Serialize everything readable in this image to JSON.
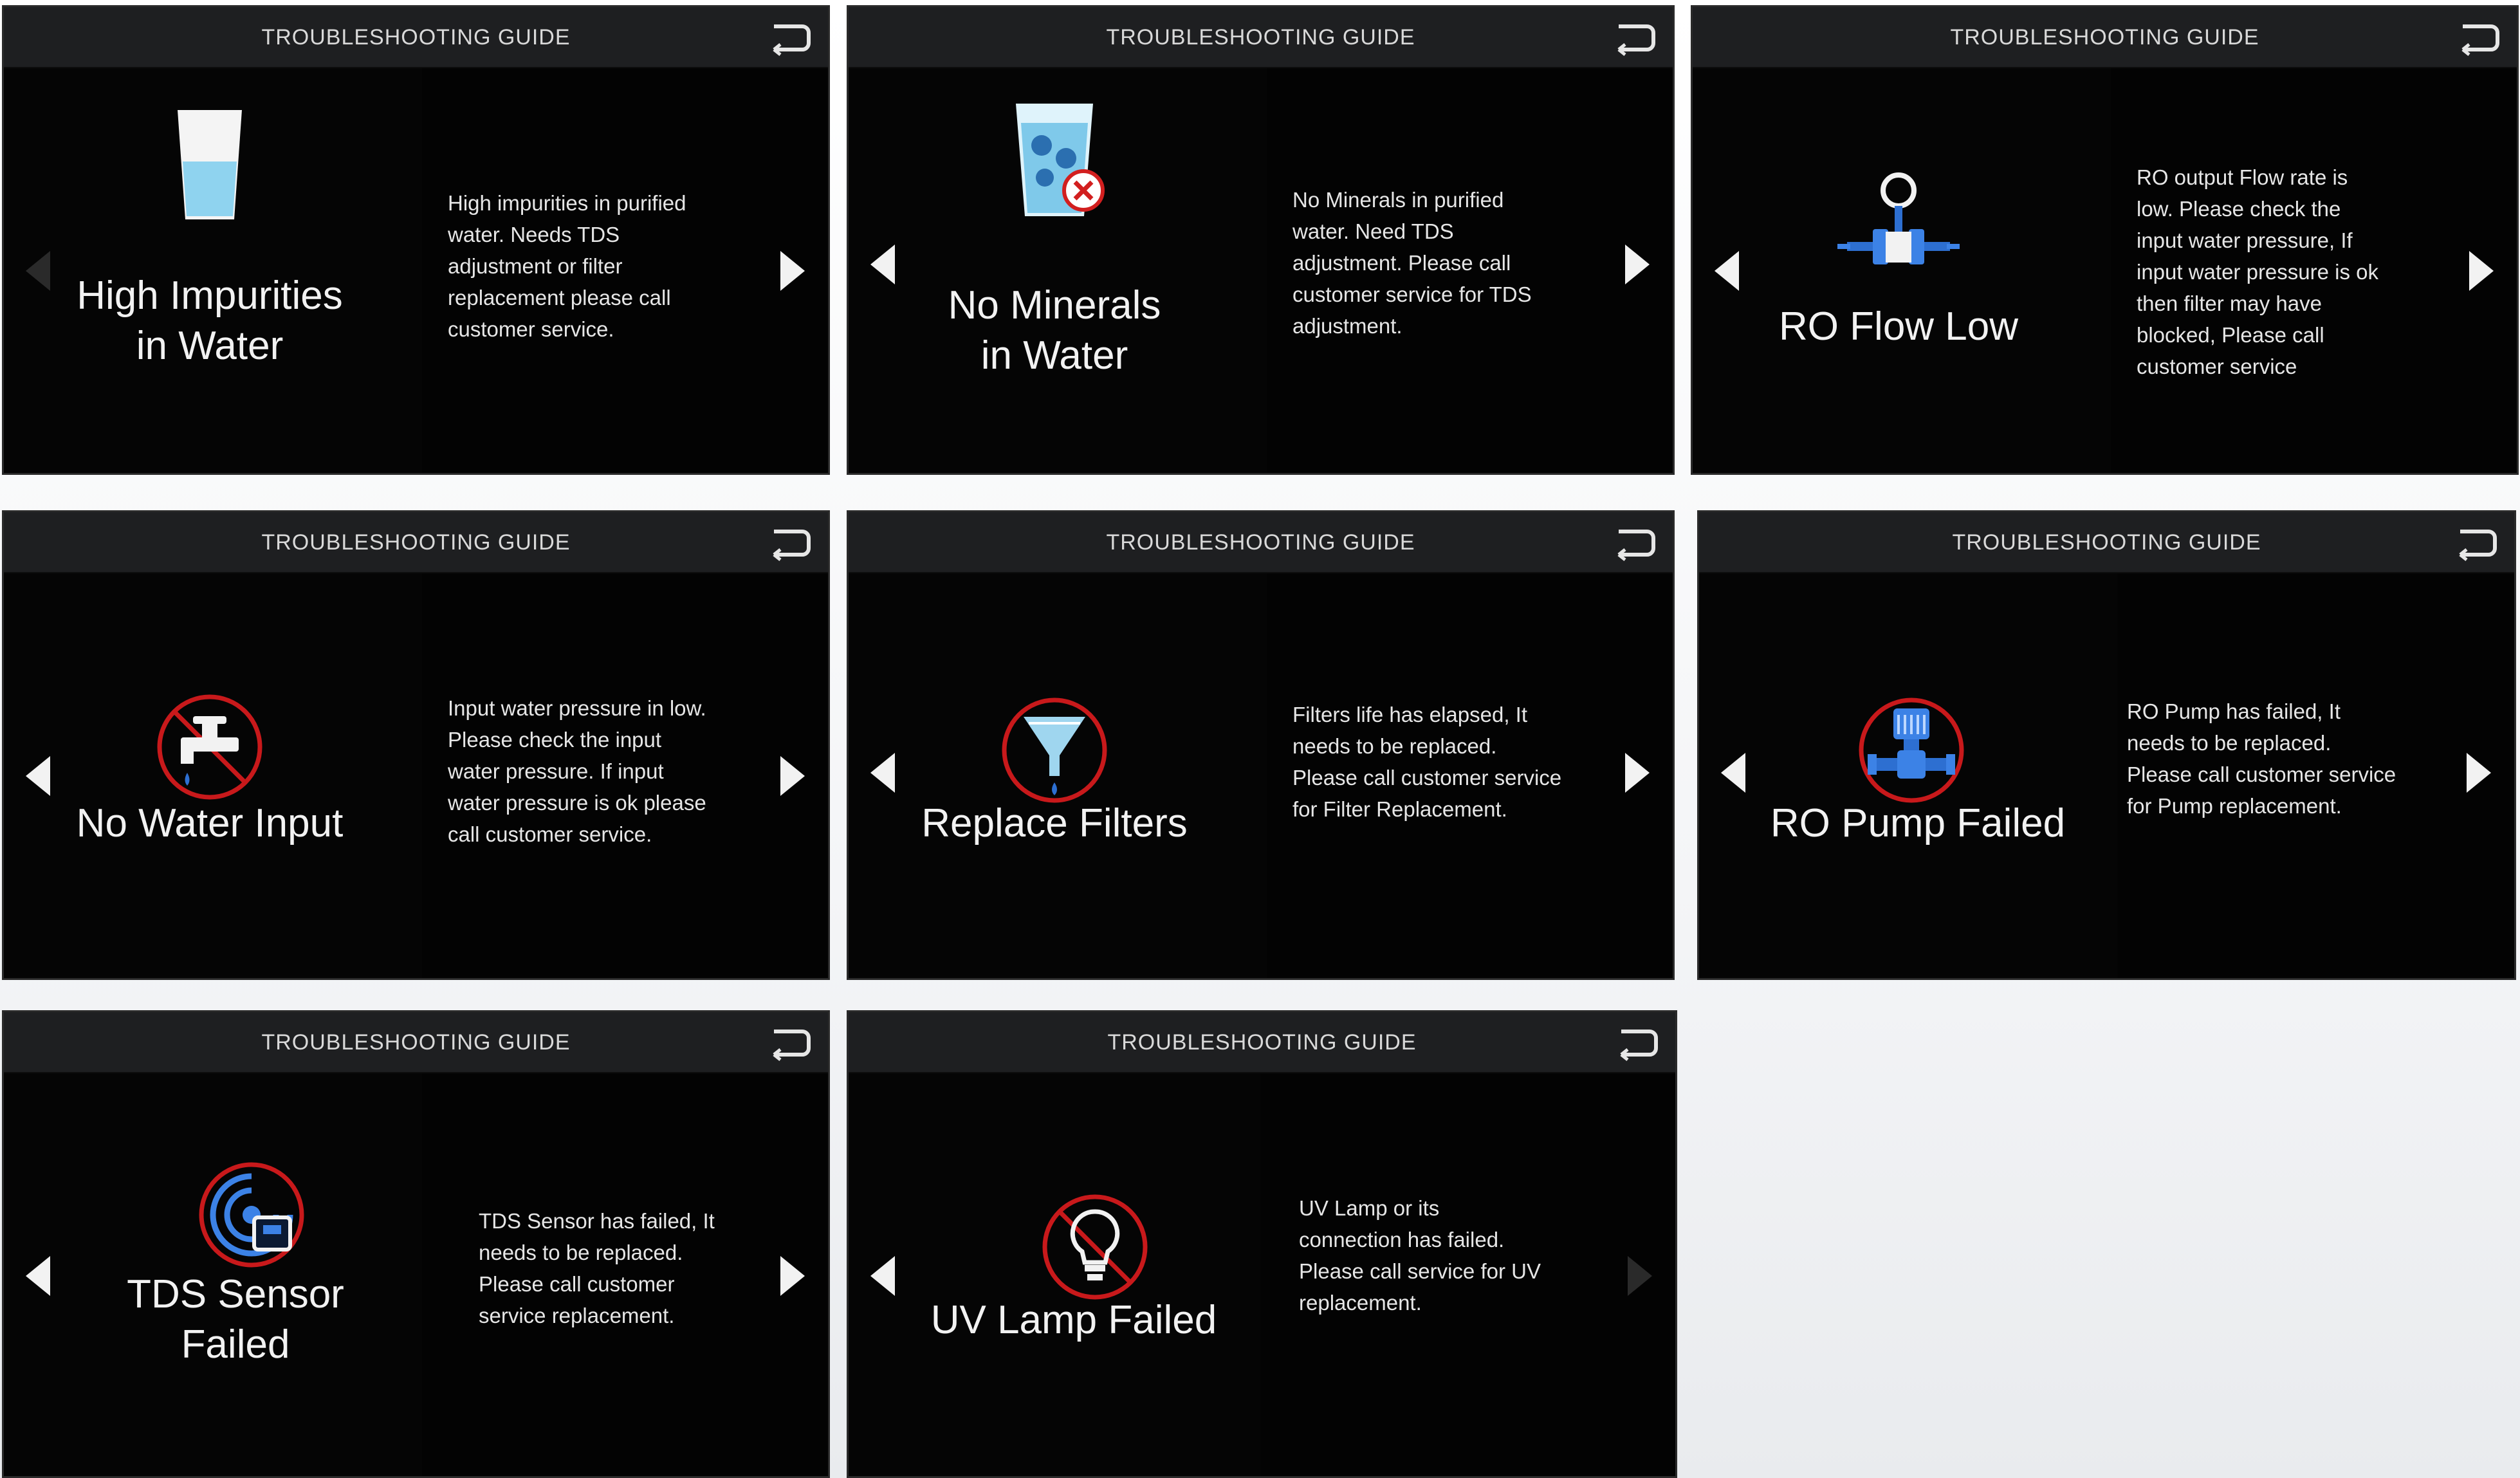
{
  "header": {
    "title": "TROUBLESHOOTING GUIDE"
  },
  "panels": [
    {
      "title": "High Impurities\nin Water",
      "icon": "water-glass-icon",
      "description": "High impurities in purified\nwater. Needs TDS\nadjustment or filter\nreplacement please call\ncustomer service."
    },
    {
      "title": "No Minerals\nin Water",
      "icon": "minerals-missing-icon",
      "description": "No Minerals in purified\nwater. Need TDS\nadjustment. Please call\ncustomer service for TDS\nadjustment."
    },
    {
      "title": "RO Flow Low",
      "icon": "flow-valve-icon",
      "description": "RO output Flow rate is\nlow. Please check the\ninput water pressure, If\ninput water pressure is ok\nthen filter may have\nblocked, Please call\ncustomer service"
    },
    {
      "title": "No Water Input",
      "icon": "no-water-tap-icon",
      "description": "Input water pressure in low.\nPlease check the input\nwater pressure. If input\nwater pressure is ok please\ncall customer service."
    },
    {
      "title": "Replace Filters",
      "icon": "filter-funnel-icon",
      "description": "Filters life has elapsed, It\nneeds to be replaced.\nPlease call customer service\nfor Filter Replacement."
    },
    {
      "title": "RO Pump Failed",
      "icon": "pump-failed-icon",
      "description": "RO Pump has failed, It\nneeds to be replaced.\nPlease call customer service\nfor Pump replacement."
    },
    {
      "title": "TDS Sensor\nFailed",
      "icon": "tds-sensor-failed-icon",
      "description": "TDS Sensor has failed, It\nneeds to be replaced.\nPlease call customer\nservice replacement."
    },
    {
      "title": "UV Lamp Failed",
      "icon": "uv-lamp-failed-icon",
      "description": "UV Lamp or its\nconnection has failed.\nPlease call service for UV\nreplacement."
    }
  ],
  "colors": {
    "header_bg": "#1e1f21",
    "panel_bg": "#000000",
    "accent_red": "#c8191b",
    "accent_blue": "#2d6fd1",
    "water_blue": "#8fd3ef"
  }
}
